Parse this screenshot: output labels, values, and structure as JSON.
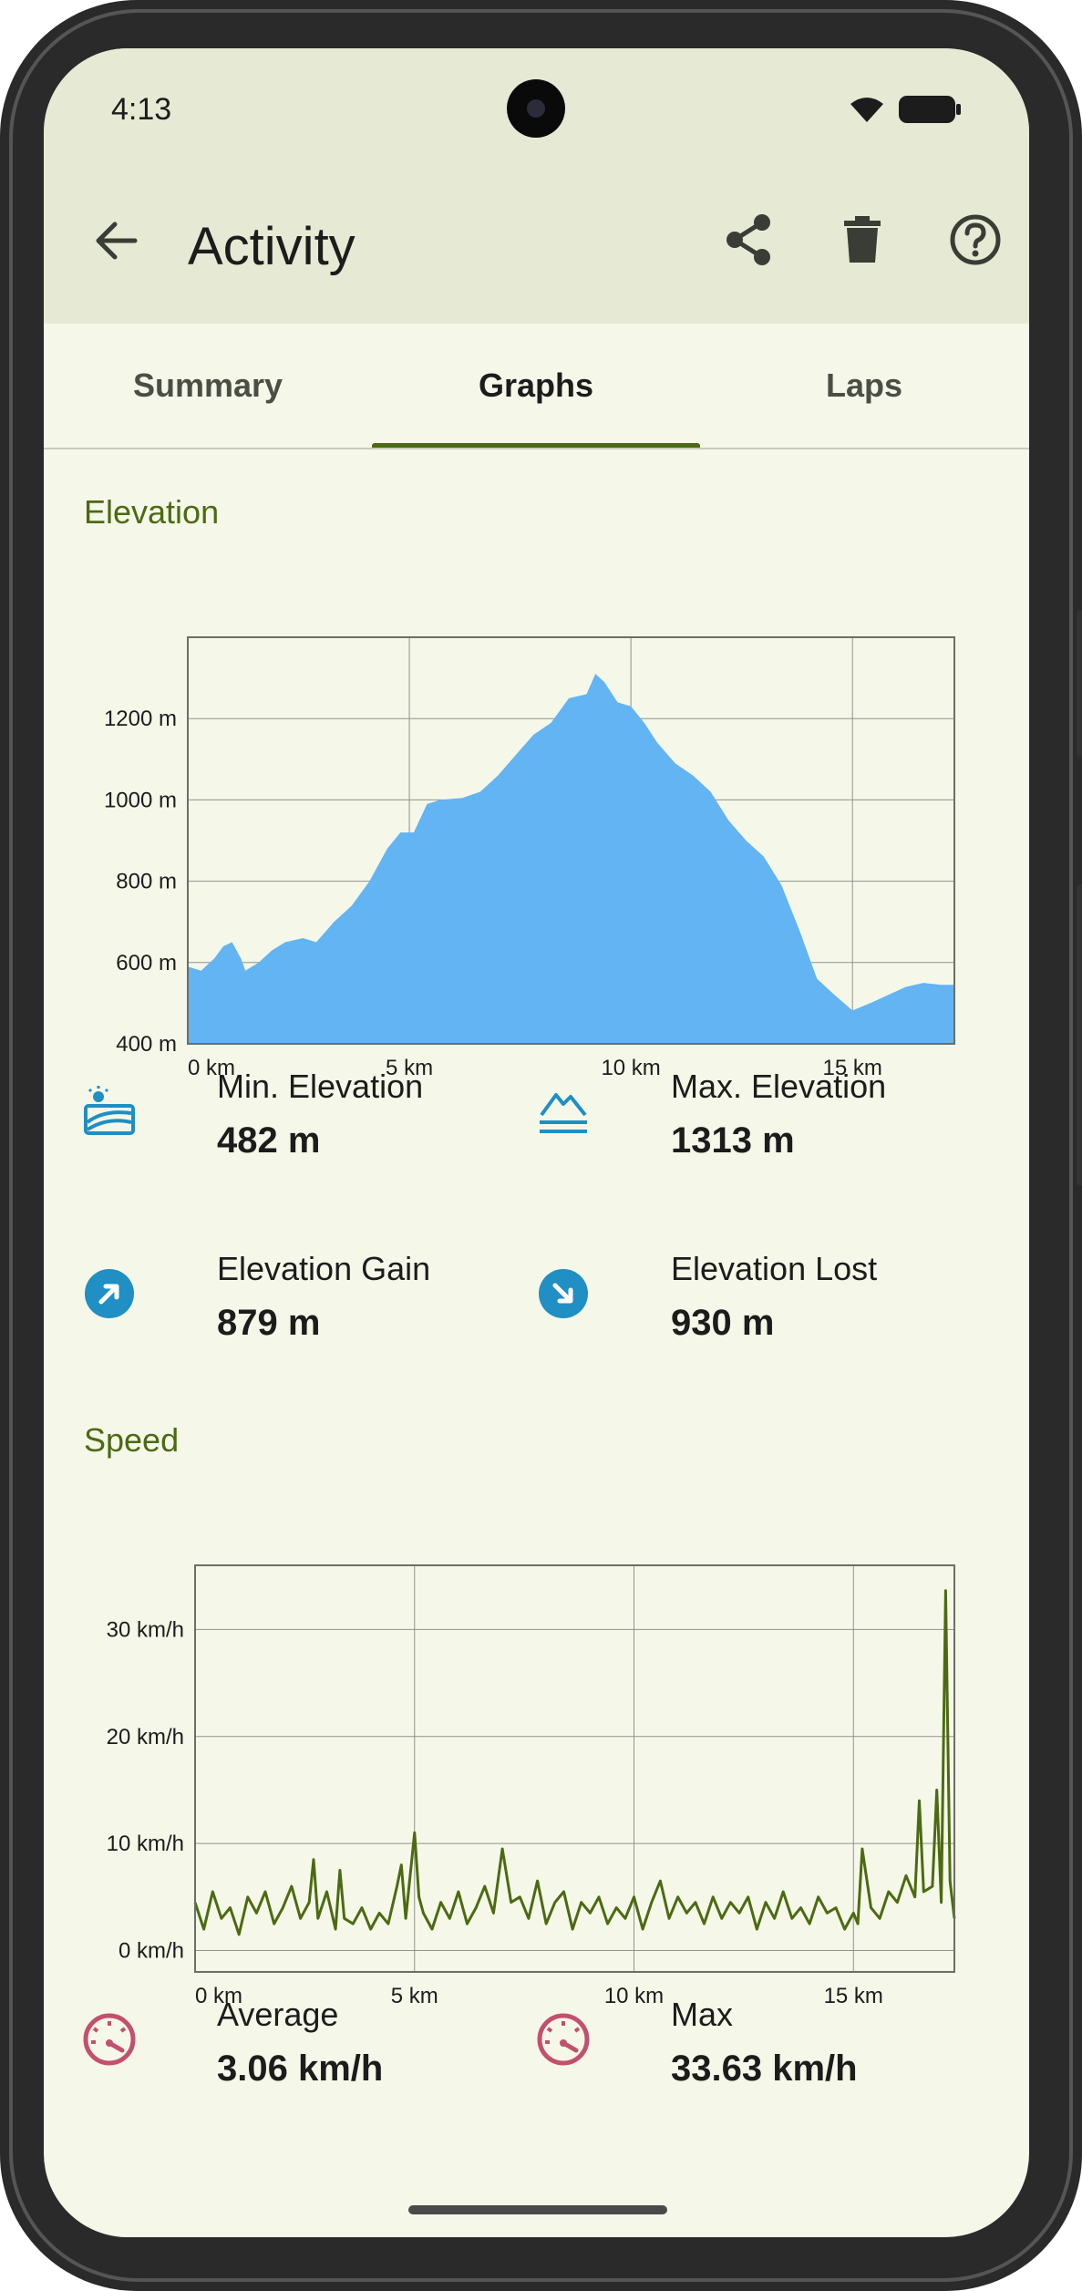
{
  "status_bar": {
    "time": "4:13",
    "wifi_icon": "wifi-icon",
    "battery_icon": "battery-icon"
  },
  "app_bar": {
    "title": "Activity",
    "back_icon": "arrow-back-icon",
    "actions": [
      "share-icon",
      "delete-icon",
      "help-icon"
    ]
  },
  "tabs": [
    {
      "label": "Summary",
      "active": false
    },
    {
      "label": "Graphs",
      "active": true
    },
    {
      "label": "Laps",
      "active": false
    }
  ],
  "elevation": {
    "title": "Elevation",
    "stats": [
      {
        "label": "Min. Elevation",
        "value": "482 m",
        "icon": "terrain-min-icon"
      },
      {
        "label": "Max. Elevation",
        "value": "1313 m",
        "icon": "terrain-max-icon"
      },
      {
        "label": "Elevation Gain",
        "value": "879 m",
        "icon": "arrow-up-right-circle-icon"
      },
      {
        "label": "Elevation Lost",
        "value": "930 m",
        "icon": "arrow-down-right-circle-icon"
      }
    ]
  },
  "speed": {
    "title": "Speed",
    "stats": [
      {
        "label": "Average",
        "value": "3.06 km/h",
        "icon": "speedometer-icon"
      },
      {
        "label": "Max",
        "value": "33.63 km/h",
        "icon": "speedometer-icon"
      }
    ]
  },
  "colors": {
    "accent": "#4c6a12",
    "elevation_fill": "#62b4f2",
    "speed_line": "#4c6a12",
    "stat_icon_blue": "#1f8fc4",
    "stat_icon_pink": "#c2506e",
    "background": "#f5f8e9",
    "app_bar": "#e6ead4"
  },
  "chart_data": [
    {
      "type": "area",
      "ylabel": "",
      "xlabel": "",
      "xlim": [
        0,
        17.3
      ],
      "ylim": [
        400,
        1400
      ],
      "x_ticks": [
        "0 km",
        "5 km",
        "10 km",
        "15 km"
      ],
      "x_tick_values": [
        0,
        5,
        10,
        15
      ],
      "y_ticks": [
        "400 m",
        "600 m",
        "800 m",
        "1000 m",
        "1200 m"
      ],
      "y_tick_values": [
        400,
        600,
        800,
        1000,
        1200
      ],
      "grid": true,
      "series": [
        {
          "x": [
            0,
            0.3,
            0.6,
            0.8,
            1.0,
            1.2,
            1.3,
            1.6,
            1.9,
            2.2,
            2.6,
            2.9,
            3.3,
            3.7,
            4.1,
            4.5,
            4.8,
            5.1,
            5.4,
            5.7,
            6.2,
            6.6,
            7.0,
            7.4,
            7.8,
            8.2,
            8.6,
            9.0,
            9.2,
            9.4,
            9.7,
            10.0,
            10.3,
            10.6,
            11.0,
            11.4,
            11.8,
            12.2,
            12.6,
            13.0,
            13.4,
            13.8,
            14.2,
            14.6,
            15.0,
            15.4,
            15.8,
            16.2,
            16.6,
            17.0,
            17.3
          ],
          "y": [
            590,
            580,
            610,
            640,
            650,
            610,
            580,
            600,
            630,
            650,
            660,
            650,
            700,
            740,
            800,
            880,
            920,
            920,
            990,
            1000,
            1005,
            1020,
            1060,
            1110,
            1160,
            1190,
            1250,
            1260,
            1310,
            1290,
            1240,
            1230,
            1190,
            1140,
            1090,
            1060,
            1020,
            950,
            900,
            860,
            790,
            680,
            560,
            520,
            482,
            500,
            520,
            540,
            550,
            545,
            545
          ]
        }
      ]
    },
    {
      "type": "line",
      "ylabel": "",
      "xlabel": "",
      "xlim": [
        0,
        17.3
      ],
      "ylim": [
        -2,
        36
      ],
      "x_ticks": [
        "0 km",
        "5 km",
        "10 km",
        "15 km"
      ],
      "x_tick_values": [
        0,
        5,
        10,
        15
      ],
      "y_ticks": [
        "0 km/h",
        "10 km/h",
        "20 km/h",
        "30 km/h"
      ],
      "y_tick_values": [
        0,
        10,
        20,
        30
      ],
      "grid": true,
      "series": [
        {
          "x": [
            0,
            0.2,
            0.4,
            0.6,
            0.8,
            1.0,
            1.2,
            1.4,
            1.6,
            1.8,
            2.0,
            2.2,
            2.4,
            2.6,
            2.7,
            2.8,
            3.0,
            3.2,
            3.3,
            3.4,
            3.6,
            3.8,
            4.0,
            4.2,
            4.4,
            4.6,
            4.7,
            4.8,
            5.0,
            5.1,
            5.2,
            5.4,
            5.6,
            5.8,
            6.0,
            6.2,
            6.4,
            6.6,
            6.8,
            7.0,
            7.2,
            7.4,
            7.6,
            7.8,
            8.0,
            8.2,
            8.4,
            8.6,
            8.8,
            9.0,
            9.2,
            9.4,
            9.6,
            9.8,
            10.0,
            10.2,
            10.4,
            10.6,
            10.8,
            11.0,
            11.2,
            11.4,
            11.6,
            11.8,
            12.0,
            12.2,
            12.4,
            12.6,
            12.8,
            13.0,
            13.2,
            13.4,
            13.6,
            13.8,
            14.0,
            14.2,
            14.4,
            14.6,
            14.8,
            15.0,
            15.1,
            15.2,
            15.4,
            15.6,
            15.8,
            16.0,
            16.2,
            16.4,
            16.5,
            16.6,
            16.8,
            16.9,
            17.0,
            17.1,
            17.2,
            17.3
          ],
          "y": [
            4.5,
            2.0,
            5.5,
            3.0,
            4.0,
            1.5,
            5.0,
            3.5,
            5.5,
            2.5,
            4.0,
            6.0,
            3.0,
            4.5,
            8.5,
            3.0,
            5.5,
            2.0,
            7.5,
            3.0,
            2.5,
            4.0,
            2.0,
            3.5,
            2.5,
            6.0,
            8.0,
            3.0,
            11.0,
            5.0,
            3.5,
            2.0,
            4.5,
            3.0,
            5.5,
            2.5,
            4.0,
            6.0,
            3.5,
            9.5,
            4.5,
            5.0,
            3.0,
            6.5,
            2.5,
            4.5,
            5.5,
            2.0,
            4.5,
            3.5,
            5.0,
            2.5,
            4.0,
            3.0,
            5.0,
            2.0,
            4.5,
            6.5,
            3.0,
            5.0,
            3.5,
            4.5,
            2.5,
            5.0,
            3.0,
            4.5,
            3.5,
            5.0,
            2.0,
            4.5,
            3.0,
            5.5,
            3.0,
            4.0,
            2.5,
            5.0,
            3.5,
            4.0,
            2.0,
            3.5,
            2.5,
            9.5,
            4.0,
            3.0,
            5.5,
            4.5,
            7.0,
            5.0,
            14.0,
            5.5,
            6.0,
            15.0,
            4.5,
            33.63,
            6.5,
            3.0
          ]
        }
      ]
    }
  ]
}
